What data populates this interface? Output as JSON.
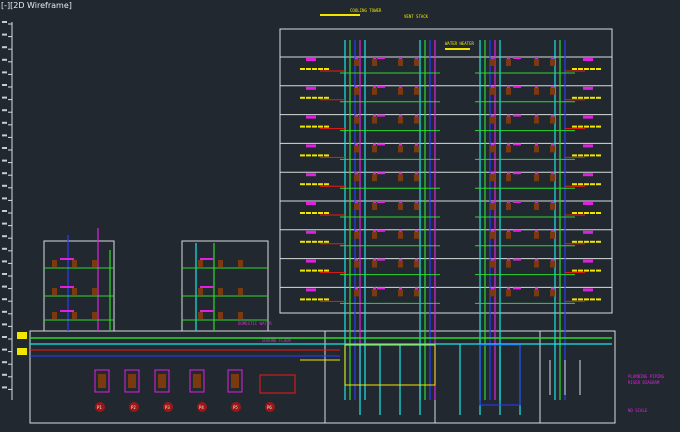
{
  "viewport": {
    "title": "[-][2D Wireframe]"
  },
  "colors": {
    "background": "#212830",
    "frame": "#d8dcdc",
    "riser_cyan": "#19e6e6",
    "riser_green": "#2ed82e",
    "riser_blue": "#2a3cff",
    "riser_magenta": "#e020e0",
    "riser_yellow": "#f0e600",
    "riser_red": "#f01818",
    "fixture_brown": "#7a3a10"
  },
  "diagram": {
    "sheet_title_line1": "PLUMBING PIPING",
    "sheet_title_line2": "RISER DIAGRAM",
    "sheet_note": "NO SCALE",
    "tower_top_left_label": "COOLING TOWER",
    "tower_top_right_label": "VENT STACK",
    "upper_note": "WATER HEATER",
    "header_left": "DOMESTIC WATER",
    "ground_label": "GROUND FLOOR",
    "equipment_tags": [
      "P1",
      "P2",
      "P3",
      "P4",
      "P5",
      "P6"
    ]
  }
}
